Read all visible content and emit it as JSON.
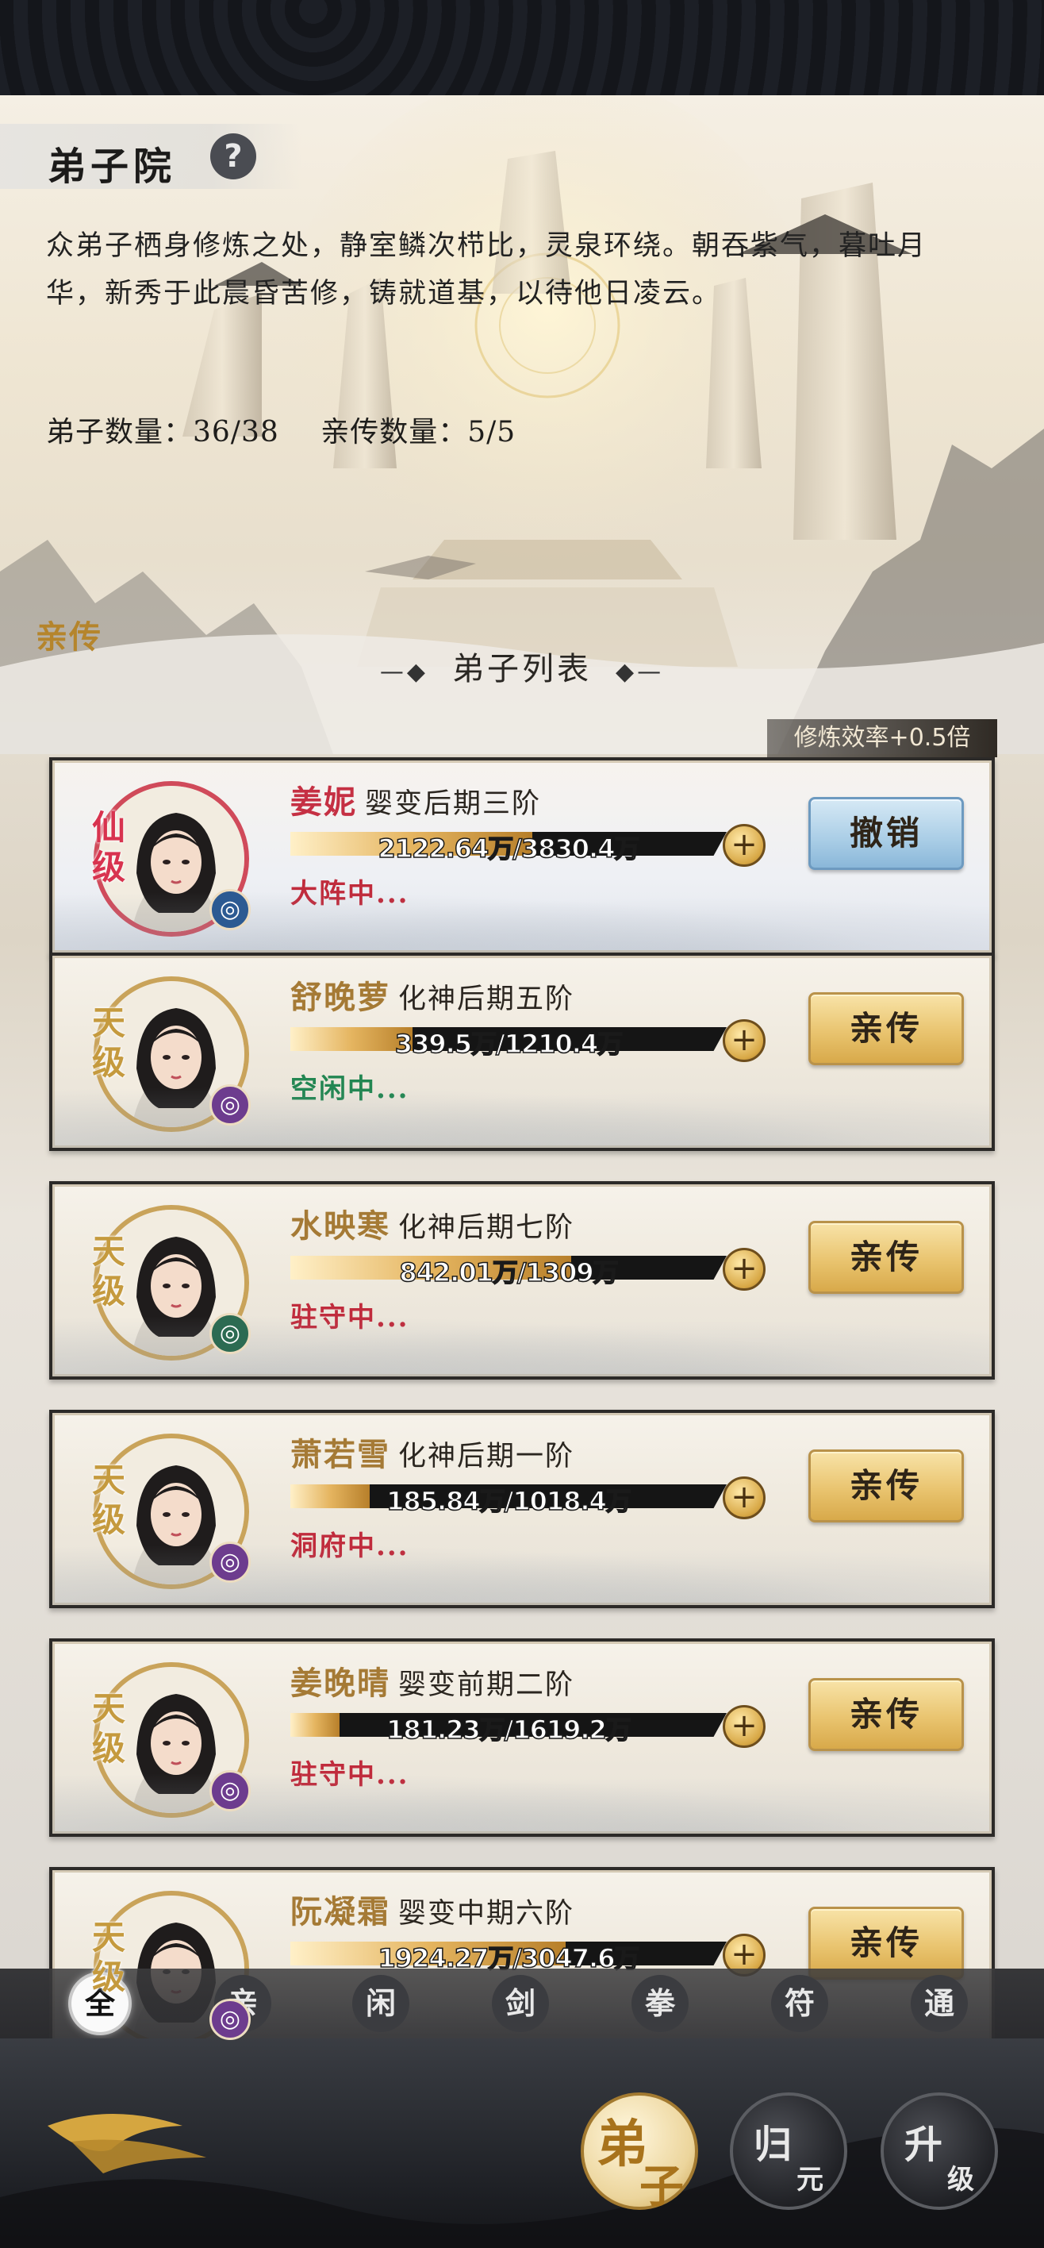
{
  "header": {
    "title": "弟子院",
    "help_icon": "?",
    "description": "众弟子栖身修炼之处，静室鳞次栉比，灵泉环绕。朝吞紫气，暮吐月华，新秀于此晨昏苦修，铸就道基，以待他日凌云。",
    "disciple_count": "弟子数量：36/38",
    "direct_count": "亲传数量：5/5"
  },
  "list": {
    "title": "弟子列表",
    "deco_left": "—◆",
    "deco_right": "◆—",
    "direct_tag": "亲传",
    "efficiency_tag": "修炼效率+0.5倍"
  },
  "disciples": [
    {
      "name": "姜妮",
      "realm": "婴变后期三阶",
      "progress": "2122.64万/3830.4万",
      "progress_ratio": 0.554,
      "status": "大阵中...",
      "status_color": "red",
      "grade": "仙级",
      "action": "撤销",
      "avatar_color": "#d04a5a",
      "badge_color": "blue",
      "badge_icon": "array-icon"
    },
    {
      "name": "舒晚萝",
      "realm": "化神后期五阶",
      "progress": "339.5万/1210.4万",
      "progress_ratio": 0.28,
      "status": "空闲中...",
      "status_color": "green",
      "grade": "天级",
      "action": "亲传",
      "badge_color": "purple",
      "badge_icon": "spiral-icon"
    },
    {
      "name": "水映寒",
      "realm": "化神后期七阶",
      "progress": "842.01万/1309万",
      "progress_ratio": 0.643,
      "status": "驻守中...",
      "status_color": "red",
      "grade": "天级",
      "action": "亲传",
      "badge_color": "green",
      "badge_icon": "swirl-icon"
    },
    {
      "name": "萧若雪",
      "realm": "化神后期一阶",
      "progress": "185.84万/1018.4万",
      "progress_ratio": 0.182,
      "status": "洞府中...",
      "status_color": "red",
      "grade": "天级",
      "action": "亲传",
      "badge_color": "purple",
      "badge_icon": "spiral-icon"
    },
    {
      "name": "姜晚晴",
      "realm": "婴变前期二阶",
      "progress": "181.23万/1619.2万",
      "progress_ratio": 0.112,
      "status": "驻守中...",
      "status_color": "red",
      "grade": "天级",
      "action": "亲传",
      "badge_color": "purple",
      "badge_icon": "spiral-icon"
    },
    {
      "name": "阮凝霜",
      "realm": "婴变中期六阶",
      "progress": "1924.27万/3047.6万",
      "progress_ratio": 0.631,
      "status": "",
      "status_color": "red",
      "grade": "天级",
      "action": "亲传",
      "badge_color": "purple",
      "badge_icon": "spiral-icon"
    }
  ],
  "filters": [
    "全",
    "亲",
    "闲",
    "剑",
    "拳",
    "符",
    "通"
  ],
  "active_filter": "全",
  "bottom_nav": [
    {
      "c1": "弟",
      "c2": "子",
      "style": "gold"
    },
    {
      "c1": "归",
      "c2": "元",
      "style": "dark"
    },
    {
      "c1": "升",
      "c2": "级",
      "style": "dark"
    }
  ]
}
